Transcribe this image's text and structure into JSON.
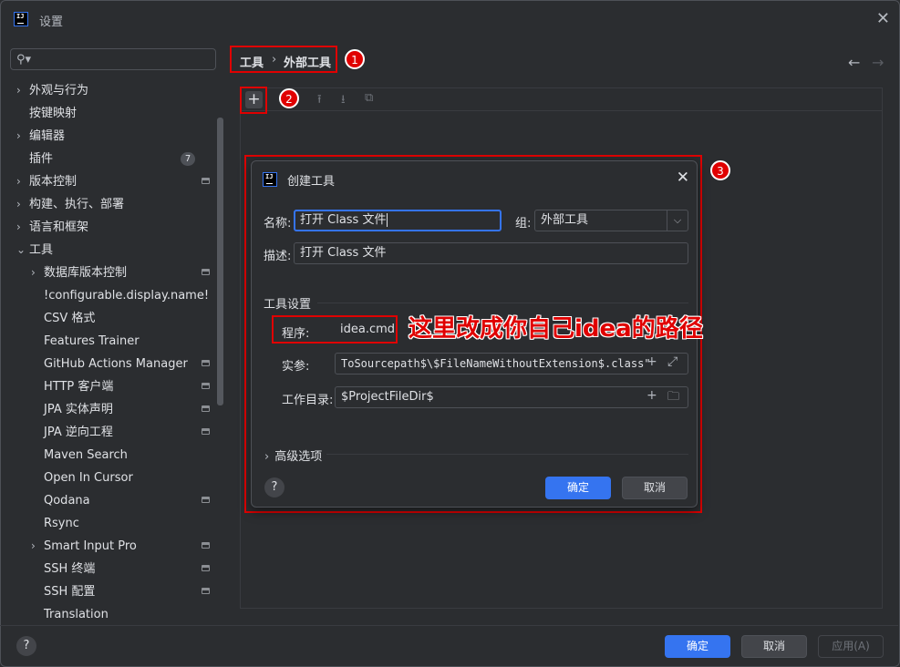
{
  "window": {
    "title": "设置",
    "logo_text": "IJ"
  },
  "search": {
    "placeholder": ""
  },
  "sidebar": {
    "items": [
      {
        "label": "外观与行为",
        "chevron": "›",
        "level": 0,
        "expanded": false
      },
      {
        "label": "按键映射",
        "level": 0
      },
      {
        "label": "编辑器",
        "chevron": "›",
        "level": 0
      },
      {
        "label": "插件",
        "level": 0,
        "badge": "7"
      },
      {
        "label": "版本控制",
        "chevron": "›",
        "level": 0,
        "module_icon": true
      },
      {
        "label": "构建、执行、部署",
        "chevron": "›",
        "level": 0
      },
      {
        "label": "语言和框架",
        "chevron": "›",
        "level": 0
      },
      {
        "label": "工具",
        "chevron": "⌄",
        "level": 0,
        "expanded": true
      },
      {
        "label": "数据库版本控制",
        "chevron": "›",
        "level": 1,
        "module_icon": true
      },
      {
        "label": "!configurable.display.name!",
        "level": 1
      },
      {
        "label": "CSV 格式",
        "level": 1
      },
      {
        "label": "Features Trainer",
        "level": 1
      },
      {
        "label": "GitHub Actions Manager",
        "level": 1,
        "module_icon": true
      },
      {
        "label": "HTTP 客户端",
        "level": 1,
        "module_icon": true
      },
      {
        "label": "JPA 实体声明",
        "level": 1,
        "module_icon": true
      },
      {
        "label": "JPA 逆向工程",
        "level": 1,
        "module_icon": true
      },
      {
        "label": "Maven Search",
        "level": 1
      },
      {
        "label": "Open In Cursor",
        "level": 1
      },
      {
        "label": "Qodana",
        "level": 1,
        "module_icon": true
      },
      {
        "label": "Rsync",
        "level": 1
      },
      {
        "label": "Smart Input Pro",
        "chevron": "›",
        "level": 1,
        "module_icon": true
      },
      {
        "label": "SSH 终端",
        "level": 1,
        "module_icon": true
      },
      {
        "label": "SSH 配置",
        "level": 1,
        "module_icon": true
      },
      {
        "label": "Translation",
        "level": 1
      }
    ]
  },
  "breadcrumb": {
    "part1": "工具",
    "sep": "›",
    "part2": "外部工具"
  },
  "nav": {
    "back": "←",
    "forward": "→"
  },
  "markers": {
    "m1": "1",
    "m2": "2",
    "m3": "3"
  },
  "toolbar": {
    "add": "+",
    "up": "⭱",
    "down": "⭳",
    "copy": "⧉"
  },
  "dialog": {
    "title": "创建工具",
    "close": "✕",
    "name_label": "名称:",
    "name_value": "打开 Class 文件",
    "group_label": "组:",
    "group_value": "外部工具",
    "desc_label": "描述:",
    "desc_value": "打开 Class 文件",
    "section_tool_settings": "工具设置",
    "program_label": "程序:",
    "program_value": "idea.cmd",
    "args_label": "实参:",
    "args_value": "ToSourcepath$\\$FileNameWithoutExtension$.class\"",
    "workdir_label": "工作目录:",
    "workdir_value": "$ProjectFileDir$",
    "advanced": "高级选项",
    "help": "?",
    "ok": "确定",
    "cancel": "取消"
  },
  "annotation": "这里改成你自己idea的路径",
  "footer": {
    "help": "?",
    "ok": "确定",
    "cancel": "取消",
    "apply": "应用(A)"
  },
  "colors": {
    "accent": "#3574f0",
    "highlight_red": "#e00000",
    "background": "#2b2d30"
  }
}
